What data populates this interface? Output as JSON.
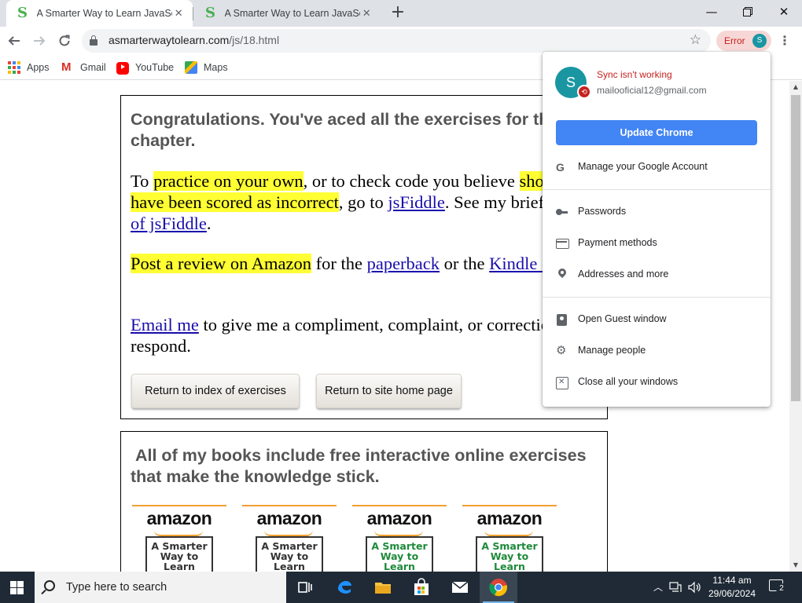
{
  "browser": {
    "tabs": [
      {
        "title": "A Smarter Way to Learn JavaScrip",
        "favicon": "S"
      },
      {
        "title": "A Smarter Way to Learn JavaScrip",
        "favicon": "S"
      }
    ],
    "url_host": "asmarterwaytolearn.com",
    "url_path": "/js/18.html",
    "error_chip": "Error",
    "profile_initial": "S"
  },
  "bookmarks": [
    {
      "label": "Apps",
      "icon": "apps-grid-icon"
    },
    {
      "label": "Gmail",
      "icon": "gmail-icon"
    },
    {
      "label": "YouTube",
      "icon": "youtube-icon"
    },
    {
      "label": "Maps",
      "icon": "maps-icon"
    }
  ],
  "page": {
    "congrats_heading": "Congratulations. You've aced all the exercises for this chapter.",
    "practice": {
      "p1": "To ",
      "hl1": "practice on your own",
      "p2": ", or to check code you believe ",
      "hl2": "shouldn't have been scored as incorrect",
      "p3": ", go to ",
      "link_jsfiddle": "jsFiddle",
      "p4": ". See my brief ",
      "link_demo": "demo of jsFiddle",
      "p5": "."
    },
    "review": {
      "hl": "Post a review on Amazon",
      "p1": " for the ",
      "link_paperback": "paperback",
      "p2": " or the ",
      "link_kindle": "Kindle edition",
      "p3": "."
    },
    "email": {
      "link": "Email me",
      "p1": " to give me a compliment, complaint, or correction. I'll respond."
    },
    "buttons": {
      "return_index": "Return to index of exercises",
      "return_home": "Return to site home page"
    },
    "books_heading": "All of my books include free interactive online exercises that make the knowledge stick.",
    "books": [
      {
        "brand": "amazon",
        "cover": "A Smarter Way to Learn JavaScript",
        "color": "#333333"
      },
      {
        "brand": "amazon",
        "cover": "A Smarter Way to Learn Python",
        "color": "#333333"
      },
      {
        "brand": "amazon",
        "cover": "A Smarter Way to Learn HTML",
        "color": "#1e8a3a"
      },
      {
        "brand": "amazon",
        "cover": "A Smarter Way to Learn jQuery",
        "color": "#1e8a3a"
      }
    ]
  },
  "profile_menu": {
    "avatar_initial": "S",
    "sync_status": "Sync isn't working",
    "email": "mailooficial12@gmail.com",
    "update_button": "Update Chrome",
    "items": [
      {
        "label": "Manage your Google Account",
        "icon": "google-g-icon"
      },
      {
        "label": "Passwords",
        "icon": "key-icon"
      },
      {
        "label": "Payment methods",
        "icon": "credit-card-icon"
      },
      {
        "label": "Addresses and more",
        "icon": "location-pin-icon"
      },
      {
        "label": "Open Guest window",
        "icon": "guest-badge-icon"
      },
      {
        "label": "Manage people",
        "icon": "gear-icon"
      },
      {
        "label": "Close all your windows",
        "icon": "close-window-icon"
      }
    ]
  },
  "taskbar": {
    "search_placeholder": "Type here to search",
    "time": "11:44 am",
    "date": "29/06/2024",
    "notification_count": "2"
  },
  "colors": {
    "highlight": "#ffff33",
    "link": "#1a0dab",
    "accent_blue": "#4285f4",
    "error_red": "#c5221f",
    "avatar_teal": "#1a96a3",
    "taskbar": "#1f2a36"
  }
}
